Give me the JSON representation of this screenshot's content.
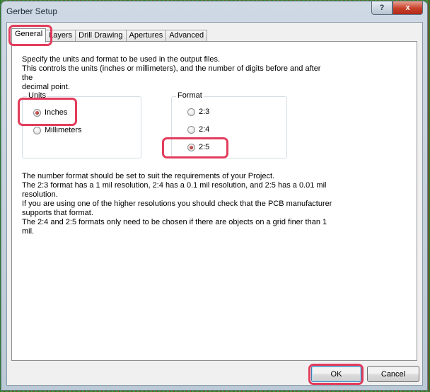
{
  "window": {
    "title": "Gerber Setup",
    "help_label": "?",
    "close_label": "x"
  },
  "tabs": [
    {
      "label": "General",
      "active": true
    },
    {
      "label": "Layers",
      "active": false
    },
    {
      "label": "Drill Drawing",
      "active": false
    },
    {
      "label": "Apertures",
      "active": false
    },
    {
      "label": "Advanced",
      "active": false
    }
  ],
  "general": {
    "intro_lines": [
      "Specify the units and format to be used in the output files.",
      "This controls the units (inches or millimeters), and the number of digits before and after the",
      "decimal point."
    ],
    "units": {
      "title": "Units",
      "options": [
        {
          "label": "Inches",
          "checked": true
        },
        {
          "label": "Millimeters",
          "checked": false
        }
      ]
    },
    "format": {
      "title": "Format",
      "options": [
        {
          "label": "2:3",
          "checked": false
        },
        {
          "label": "2:4",
          "checked": false
        },
        {
          "label": "2:5",
          "checked": true
        }
      ]
    },
    "notes_lines": [
      "The number format should be set to suit the requirements of your Project.",
      "The 2:3 format has a 1 mil resolution, 2:4 has a 0.1 mil resolution, and 2:5 has a 0.01 mil",
      "resolution.",
      "If you are using one of the higher resolutions you should check that the PCB manufacturer",
      "supports that format.",
      "The 2:4 and 2:5 formats only need to be chosen if there are objects on a grid finer than 1",
      "mil."
    ]
  },
  "buttons": {
    "ok": "OK",
    "cancel": "Cancel"
  },
  "colors": {
    "highlight": "#e23c5c",
    "title_close": "#c8402a"
  }
}
